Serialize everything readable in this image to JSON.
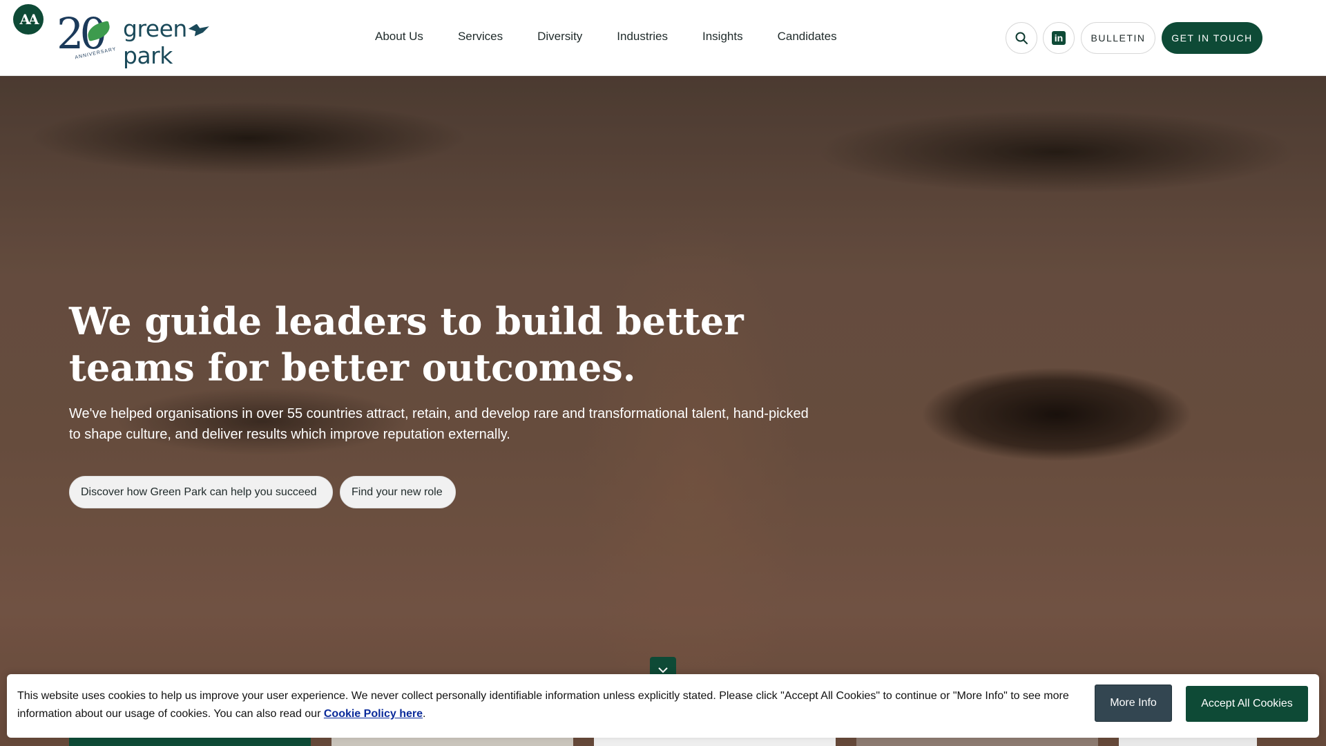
{
  "header": {
    "accessibility_label": "AA",
    "logo": {
      "number": "20",
      "anniversary": "ANNIVERSARY",
      "brand_left": "green",
      "brand_right": "park"
    },
    "nav": [
      {
        "label": "About Us"
      },
      {
        "label": "Services"
      },
      {
        "label": "Diversity"
      },
      {
        "label": "Industries"
      },
      {
        "label": "Insights"
      },
      {
        "label": "Candidates"
      }
    ],
    "bulletin_label": "BULLETIN",
    "contact_label": "GET IN TOUCH"
  },
  "hero": {
    "title": "We guide leaders to build better teams for better outcomes.",
    "subtitle": "We've helped organisations in over 55 countries attract, retain, and develop rare and transformational talent, hand-picked to shape culture, and deliver results which improve reputation externally.",
    "cta_primary": "Discover how Green Park can help you succeed",
    "cta_secondary": "Find your new role"
  },
  "cookie": {
    "text": "This website uses cookies to help us improve your user experience. We never collect personally identifiable information unless explicitly stated. Please click \"Accept All Cookies\" to continue or \"More Info\" to see more information about our usage of cookies. You can also read our ",
    "link": "Cookie Policy here",
    "after_link": ".",
    "more_info_label": "More Info",
    "accept_label": "Accept All Cookies"
  },
  "colors": {
    "brand_green": "#0e4a36",
    "dark_slate": "#334651",
    "link_blue": "#0a2a9a"
  }
}
